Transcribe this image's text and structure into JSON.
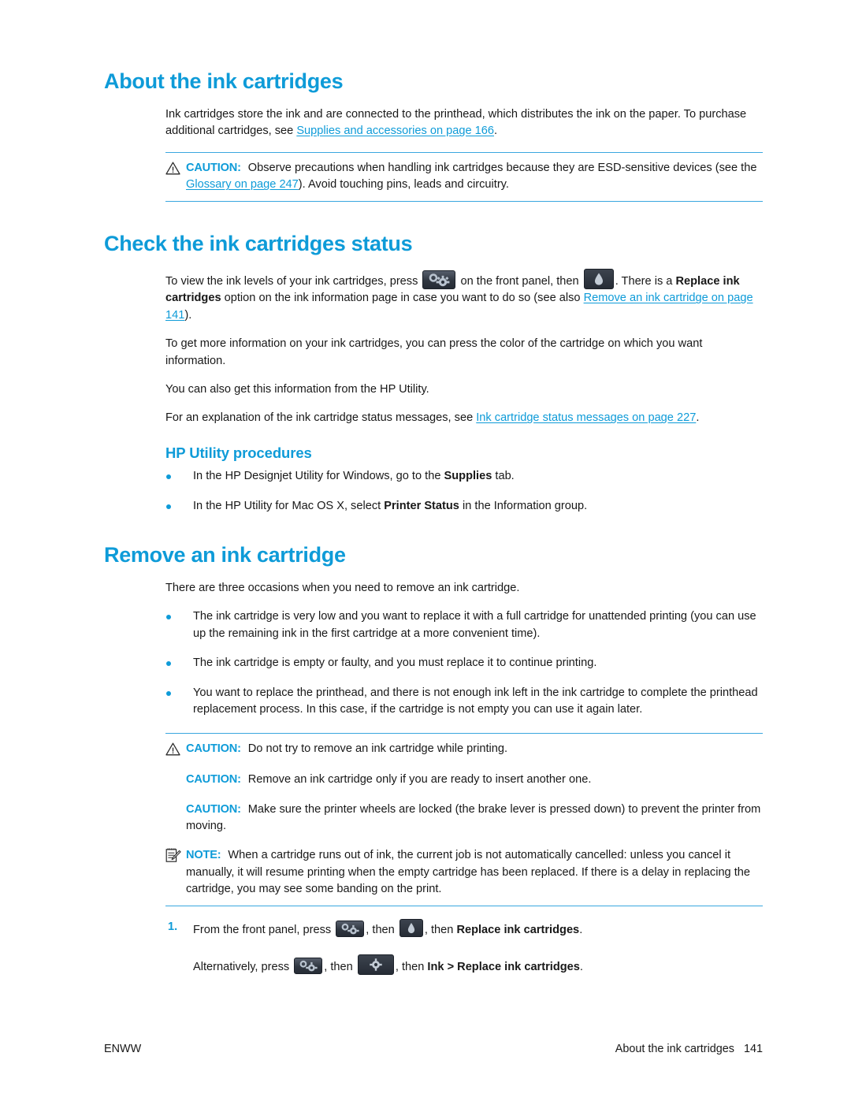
{
  "document": {
    "footer": {
      "left_label": "ENWW",
      "right_title": "About the ink cartridges",
      "page_number": "141"
    }
  },
  "sections": {
    "about": {
      "heading": "About the ink cartridges",
      "intro_part1": "Ink cartridges store the ink and are connected to the printhead, which distributes the ink on the paper. To purchase additional cartridges, see ",
      "intro_link": "Supplies and accessories on page 166",
      "intro_part2": ".",
      "caution": {
        "label": "CAUTION:",
        "text_part1": "Observe precautions when handling ink cartridges because they are ESD-sensitive devices (see the ",
        "link": "Glossary on page 247",
        "text_part2": "). Avoid touching pins, leads and circuitry."
      }
    },
    "check_status": {
      "heading": "Check the ink cartridges status",
      "p1_a": "To view the ink levels of your ink cartridges, press",
      "p1_b": "on the front panel, then",
      "p1_c": ". There is a ",
      "p1_bold1": "Replace ink cartridges",
      "p1_d": " option on the ink information page in case you want to do so (see also ",
      "p1_link": "Remove an ink cartridge on page 141",
      "p1_e": ").",
      "p2": "To get more information on your ink cartridges, you can press the color of the cartridge on which you want information.",
      "p3": "You can also get this information from the HP Utility.",
      "p4_a": "For an explanation of the ink cartridge status messages, see ",
      "p4_link": "Ink cartridge status messages on page 227",
      "p4_b": ".",
      "subheading": "HP Utility procedures",
      "bullets": [
        {
          "part1": "In the HP Designjet Utility for Windows, go to the ",
          "bold": "Supplies",
          "part2": " tab."
        },
        {
          "part1": "In the HP Utility for Mac OS X, select ",
          "bold": "Printer Status",
          "part2": " in the Information group."
        }
      ]
    },
    "remove": {
      "heading": "Remove an ink cartridge",
      "intro": "There are three occasions when you need to remove an ink cartridge.",
      "bullets": [
        "The ink cartridge is very low and you want to replace it with a full cartridge for unattended printing (you can use up the remaining ink in the first cartridge at a more convenient time).",
        "The ink cartridge is empty or faulty, and you must replace it to continue printing.",
        "You want to replace the printhead, and there is not enough ink left in the ink cartridge to complete the printhead replacement process. In this case, if the cartridge is not empty you can use it again later."
      ],
      "admonitions": [
        {
          "kind": "caution",
          "icon": "warning-triangle-icon",
          "label": "CAUTION:",
          "text": "Do not try to remove an ink cartridge while printing."
        },
        {
          "kind": "caution",
          "icon": "none",
          "label": "CAUTION:",
          "text": "Remove an ink cartridge only if you are ready to insert another one."
        },
        {
          "kind": "caution",
          "icon": "none",
          "label": "CAUTION:",
          "text": "Make sure the printer wheels are locked (the brake lever is pressed down) to prevent the printer from moving."
        },
        {
          "kind": "note",
          "icon": "note-pad-icon",
          "label": "NOTE:",
          "text": "When a cartridge runs out of ink, the current job is not automatically cancelled: unless you cancel it manually, it will resume printing when the empty cartridge has been replaced. If there is a delay in replacing the cartridge, you may see some banding on the print."
        }
      ],
      "step": {
        "number": "1.",
        "line1_a": "From the front panel, press",
        "line1_b": ", then",
        "line1_c": ", then ",
        "line1_bold": "Replace ink cartridges",
        "line1_d": ".",
        "line2_a": "Alternatively, press",
        "line2_b": ", then",
        "line2_c": ", then ",
        "line2_bold1": "Ink",
        "line2_sep": " > ",
        "line2_bold2": "Replace ink cartridges",
        "line2_d": "."
      }
    }
  },
  "icons": {
    "front_panel_gears": "front-panel-gears-icon",
    "front_panel_drop": "front-panel-ink-drop-icon",
    "front_panel_gear": "front-panel-gear-icon"
  },
  "colors": {
    "heading_blue": "#0e9bd8",
    "link_blue": "#0e9bd8",
    "rule_blue": "#3aa7df",
    "body_text": "#181818",
    "icon_dark": "#303742"
  }
}
